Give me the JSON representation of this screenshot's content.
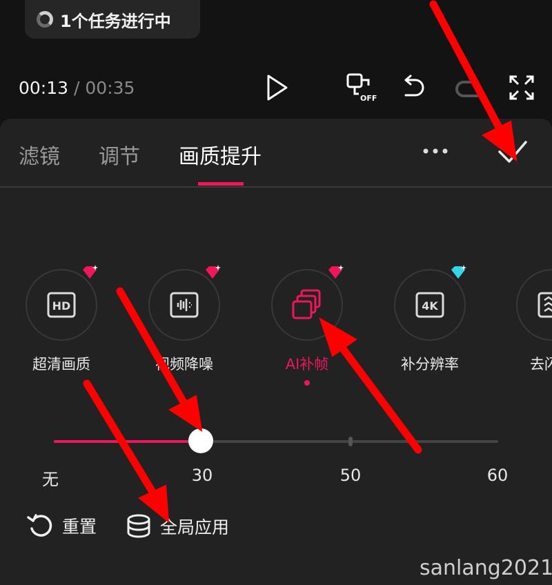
{
  "task_status": {
    "text": "1个任务进行中"
  },
  "player": {
    "current_time": "00:13",
    "separator": "/",
    "duration": "00:35"
  },
  "tabs": [
    {
      "label": "滤镜"
    },
    {
      "label": "调节"
    },
    {
      "label": "画质提升"
    }
  ],
  "tools": [
    {
      "label": "超清画质",
      "icon": "hd-icon",
      "badge": "pink-diamond-icon"
    },
    {
      "label": "视频降噪",
      "icon": "noise-reduction-icon",
      "badge": "pink-diamond-icon"
    },
    {
      "label": "AI补帧",
      "icon": "frame-interpolation-icon",
      "badge": "pink-diamond-icon"
    },
    {
      "label": "补分辨率",
      "icon": "4k-icon",
      "badge": "blue-diamond-icon"
    },
    {
      "label": "去闪",
      "icon": "deflicker-icon"
    }
  ],
  "slider": {
    "ticks": [
      "无",
      "30",
      "50",
      "60"
    ],
    "value_fraction": 0.33
  },
  "actions": {
    "reset": "重置",
    "apply_all": "全局应用"
  },
  "watermark": "sanlang2021",
  "colors": {
    "accent": "#f0165a",
    "panel": "#222222",
    "background": "#131313"
  }
}
